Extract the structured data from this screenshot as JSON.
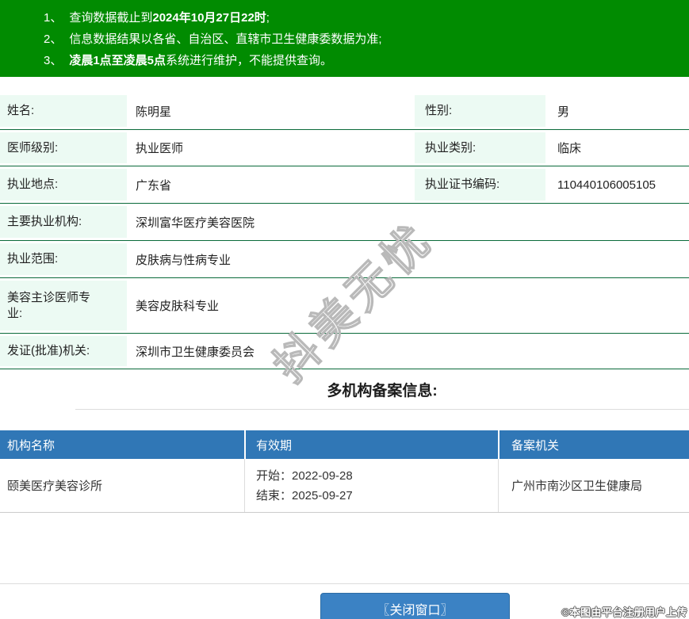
{
  "notice": {
    "items": [
      {
        "num": "1、",
        "pre": "查询数据截止到",
        "bold": "2024年10月27日22时",
        "post": ";"
      },
      {
        "num": "2、",
        "pre": "信息数据结果以各省、自治区、直辖市卫生健康委数据为准;",
        "bold": "",
        "post": ""
      },
      {
        "num": "3、",
        "pre": "",
        "bold": "凌晨1点至凌晨5点",
        "post": "系统进行维护，不能提供查询。"
      }
    ]
  },
  "details": {
    "rows": [
      {
        "label": "姓名:",
        "value": "陈明星",
        "label2": "性别:",
        "value2": "男"
      },
      {
        "label": "医师级别:",
        "value": "执业医师",
        "label2": "执业类别:",
        "value2": "临床"
      },
      {
        "label": "执业地点:",
        "value": "广东省",
        "label2": "执业证书编码:",
        "value2": "110440106005105"
      },
      {
        "label": "主要执业机构:",
        "value": "深圳富华医疗美容医院"
      },
      {
        "label": "执业范围:",
        "value": "皮肤病与性病专业"
      },
      {
        "label": "美容主诊医师专业:",
        "value": "美容皮肤科专业"
      },
      {
        "label": "发证(批准)机关:",
        "value": "深圳市卫生健康委员会"
      }
    ]
  },
  "section_title": "多机构备案信息:",
  "filing_table": {
    "headers": {
      "name": "机构名称",
      "validity": "有效期",
      "authority": "备案机关"
    },
    "row": {
      "name": "颐美医疗美容诊所",
      "start": "开始：2022-09-28",
      "end": "结束：2025-09-27",
      "authority": "广州市南沙区卫生健康局"
    }
  },
  "close_button_label": "〖关闭窗口〗",
  "watermark_text": "抖美无忧",
  "credit_text": "©本图由平台注册用户上传",
  "colors": {
    "banner_green": "#018b01",
    "row_rule_green": "#0a6a3a",
    "label_mint": "#ecfaf3",
    "table_header_blue": "#3077b6",
    "button_blue": "#3b82c4"
  }
}
